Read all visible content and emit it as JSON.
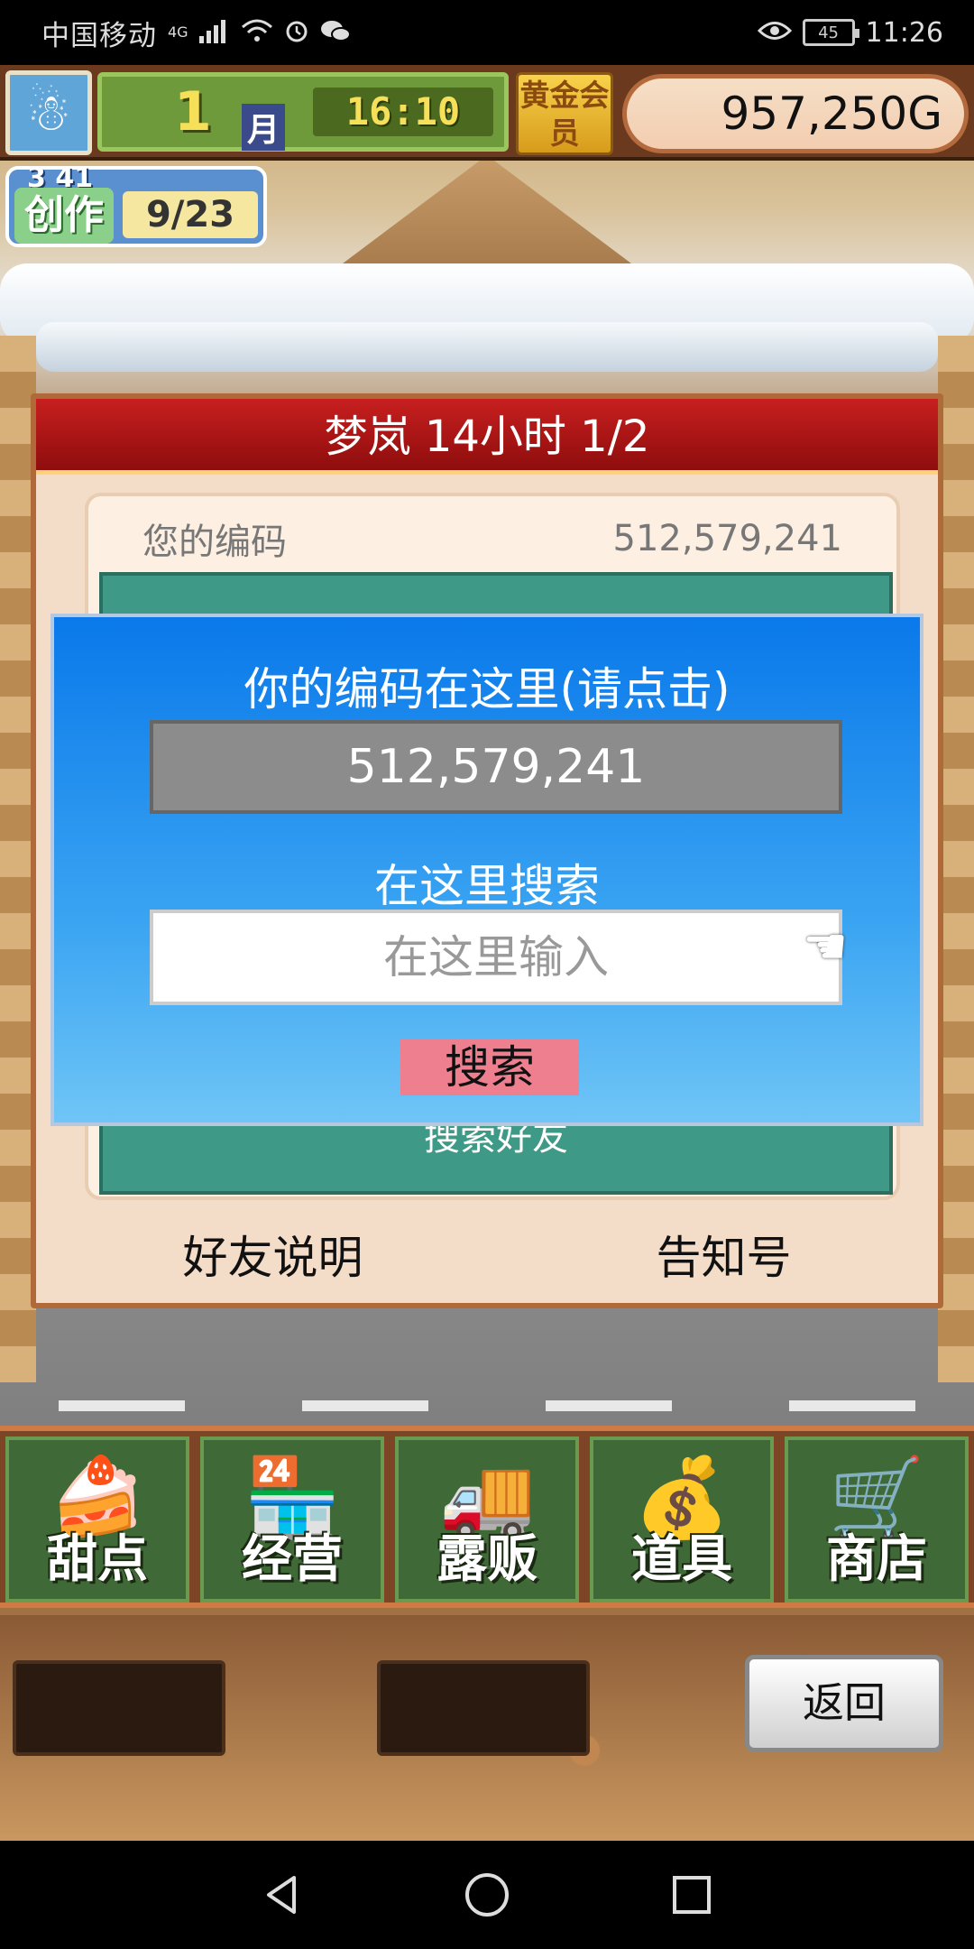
{
  "status_bar": {
    "carrier": "中国移动",
    "network": "4G",
    "battery": "45",
    "time": "11:26"
  },
  "hud": {
    "month_number": "1",
    "month_unit": "月",
    "game_time": "16:10",
    "gold_member": "黄金会员",
    "money": "957,250G",
    "create_level": "3 41",
    "create_label": "创作",
    "create_progress": "9/23"
  },
  "friend_panel": {
    "title": "梦岚  14小时 1/2",
    "your_code_label": "您的编码",
    "your_code_value": "512,579,241",
    "search_friend_label": "搜索好友",
    "footer_left": "好友说明",
    "footer_right": "告知号"
  },
  "dialog": {
    "title": "你的编码在这里(请点击)",
    "code_value": "512,579,241",
    "search_prompt": "在这里搜索",
    "input_placeholder": "在这里输入",
    "search_button": "搜索"
  },
  "menu": {
    "items": [
      {
        "label": "甜点",
        "icon": "cake-icon"
      },
      {
        "label": "经营",
        "icon": "shop-building-icon"
      },
      {
        "label": "露贩",
        "icon": "food-truck-icon"
      },
      {
        "label": "道具",
        "icon": "item-bag-icon"
      },
      {
        "label": "商店",
        "icon": "shopping-cart-icon"
      }
    ]
  },
  "bottom": {
    "back_button": "返回"
  }
}
